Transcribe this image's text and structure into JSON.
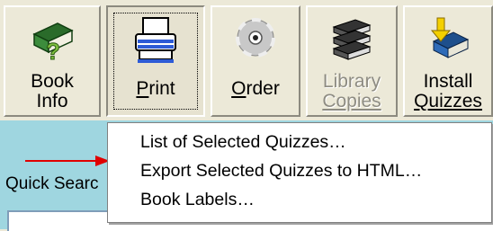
{
  "toolbar": {
    "buttons": [
      {
        "label_line1": "Book",
        "label_line2": "Info",
        "icon": "book-question-icon",
        "disabled": false
      },
      {
        "label": "Print",
        "mnemonic_index": 0,
        "icon": "printer-icon",
        "state": "pressed"
      },
      {
        "label": "Order",
        "mnemonic_index": 0,
        "icon": "cd-disc-icon",
        "disabled": false
      },
      {
        "label_line1": "Library",
        "label_line2": "Copies",
        "icon": "book-stack-icon",
        "disabled": true
      },
      {
        "label_line1": "Install",
        "label_line2": "Quizzes",
        "icon": "install-book-icon",
        "disabled": false
      }
    ]
  },
  "panel": {
    "quick_search_label": "Quick Searc"
  },
  "print_menu": {
    "items": [
      "List of Selected Quizzes…",
      "Export Selected Quizzes to HTML…",
      "Book Labels…"
    ]
  },
  "colors": {
    "toolbar_bg": "#ece9d8",
    "panel_bg": "#9fd6e0",
    "arrow": "#e00000"
  }
}
